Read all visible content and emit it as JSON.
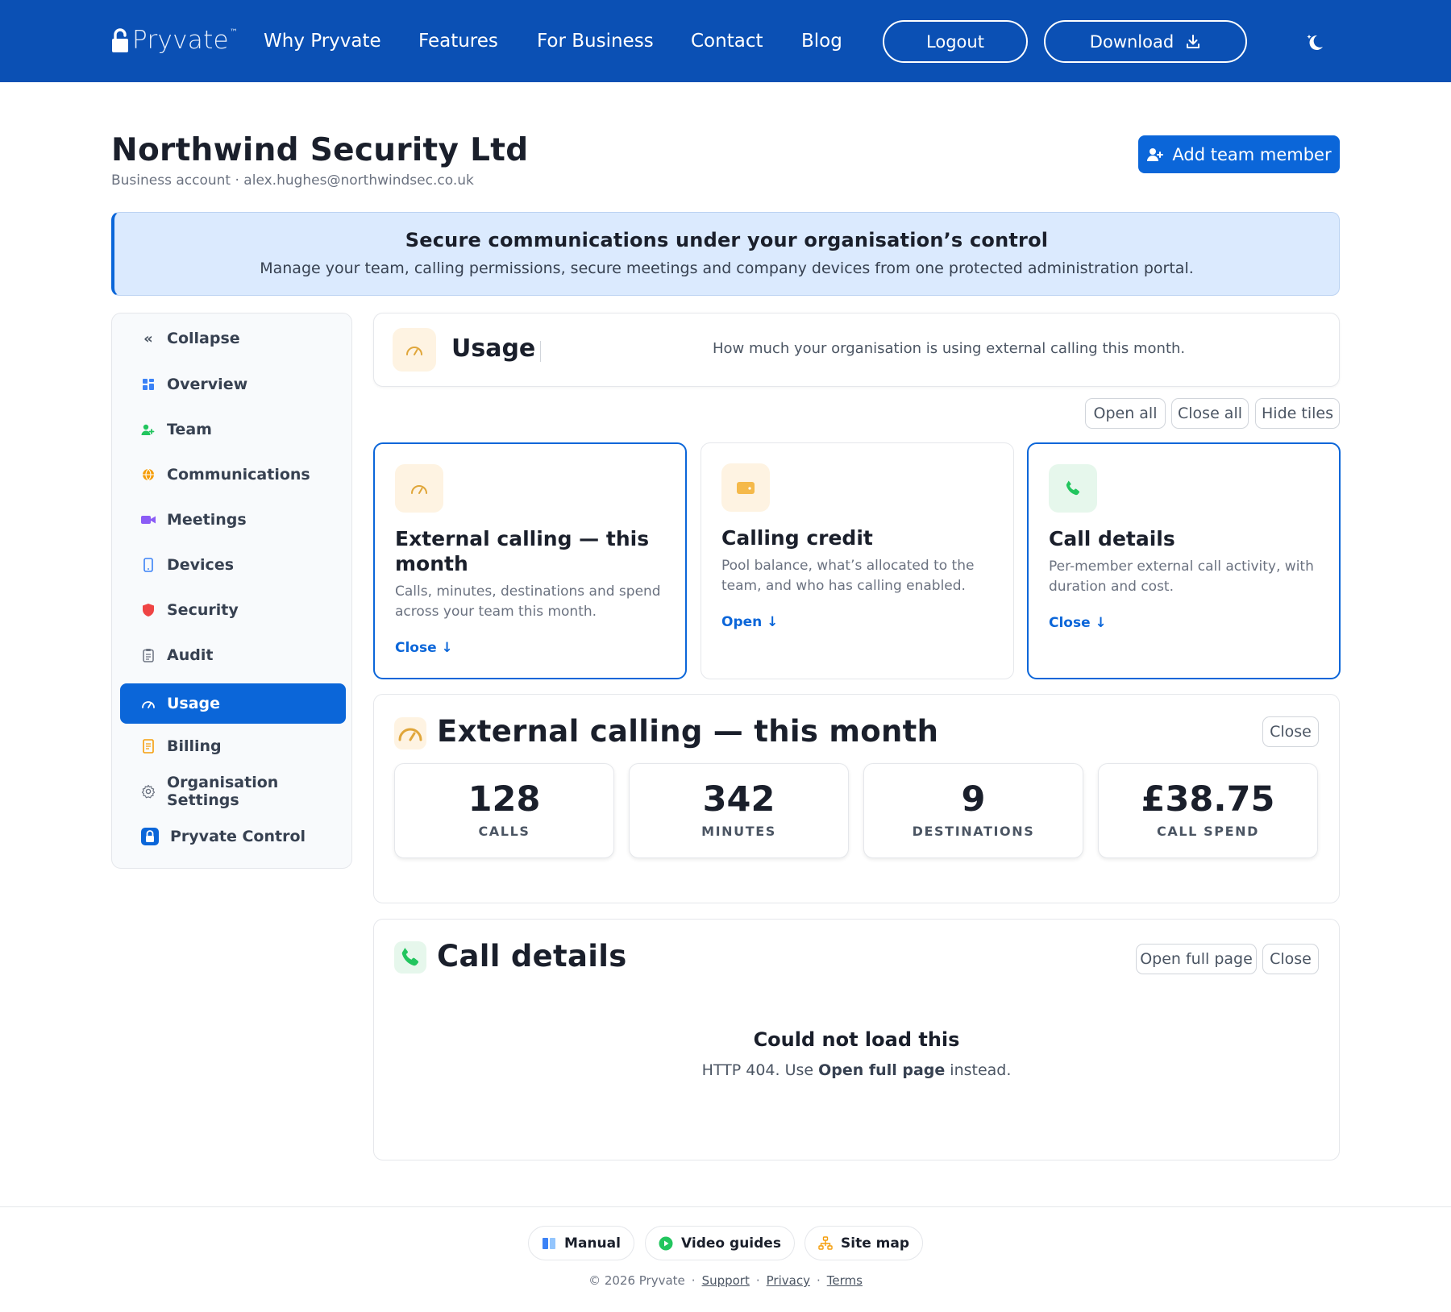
{
  "nav": {
    "logo": "Pryvate",
    "logo_tm": "™",
    "links": [
      "Why Pryvate",
      "Features",
      "For Business",
      "Contact",
      "Blog"
    ],
    "logout": "Logout",
    "download": "Download"
  },
  "header": {
    "org_name": "Northwind Security Ltd",
    "account_line": "Business account · alex.hughes@northwindsec.co.uk",
    "add_member": "Add team member"
  },
  "banner": {
    "title": "Secure communications under your organisation’s control",
    "text": "Manage your team, calling permissions, secure meetings and company devices from one protected administration portal."
  },
  "sidebar": {
    "collapse": "Collapse",
    "items": [
      {
        "label": "Overview",
        "icon": "grid-icon",
        "color": "#3b82f6"
      },
      {
        "label": "Team",
        "icon": "users-icon",
        "color": "#22c55e"
      },
      {
        "label": "Communications",
        "icon": "globe-icon",
        "color": "#f59e0b"
      },
      {
        "label": "Meetings",
        "icon": "video-icon",
        "color": "#8b5cf6"
      },
      {
        "label": "Devices",
        "icon": "phone-device-icon",
        "color": "#3b82f6"
      },
      {
        "label": "Security",
        "icon": "shield-icon",
        "color": "#ef4444"
      },
      {
        "label": "Audit",
        "icon": "clipboard-icon",
        "color": "#6b7280"
      },
      {
        "label": "Usage",
        "icon": "gauge-icon",
        "color": "#ffffff",
        "active": true
      },
      {
        "label": "Billing",
        "icon": "receipt-icon",
        "color": "#f59e0b"
      },
      {
        "label": "Organisation Settings",
        "icon": "gear-icon",
        "color": "#6b7280"
      },
      {
        "label": "Pryvate Control",
        "icon": "lock-icon",
        "color": "#0b66d9"
      }
    ]
  },
  "usage": {
    "title": "Usage",
    "description": "How much your organisation is using external calling this month.",
    "actions": {
      "open_all": "Open all",
      "close_all": "Close all",
      "hide_tiles": "Hide tiles"
    },
    "tiles": [
      {
        "title": "External calling — this month",
        "desc": "Calls, minutes, destinations and spend across your team this month.",
        "link": "Close ↓",
        "selected": true
      },
      {
        "title": "Calling credit",
        "desc": "Pool balance, what’s allocated to the team, and who has calling enabled.",
        "link": "Open ↓",
        "selected": false
      },
      {
        "title": "Call details",
        "desc": "Per-member external call activity, with duration and cost.",
        "link": "Close ↓",
        "selected": true
      }
    ]
  },
  "external_calling": {
    "title": "External calling — this month",
    "close": "Close",
    "stats": [
      {
        "value": "128",
        "label": "CALLS"
      },
      {
        "value": "342",
        "label": "MINUTES"
      },
      {
        "value": "9",
        "label": "DESTINATIONS"
      },
      {
        "value": "£38.75",
        "label": "CALL SPEND"
      }
    ]
  },
  "call_details": {
    "title": "Call details",
    "open_full": "Open full page",
    "close": "Close",
    "error_title": "Could not load this",
    "error_prefix": "HTTP 404. Use ",
    "error_bold": "Open full page",
    "error_suffix": " instead."
  },
  "footer": {
    "manual": "Manual",
    "video_guides": "Video guides",
    "site_map": "Site map",
    "copyright": "© 2026 Pryvate",
    "support": "Support",
    "privacy": "Privacy",
    "terms": "Terms"
  }
}
